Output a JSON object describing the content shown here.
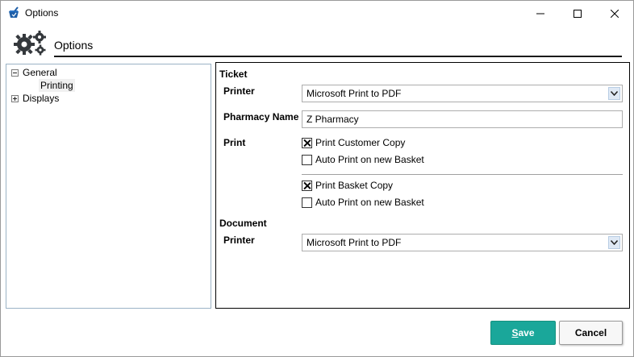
{
  "window": {
    "title": "Options",
    "icons": {
      "app": "pharmacy-mortar-icon",
      "minimize": "minimize-icon",
      "maximize": "maximize-icon",
      "close": "close-icon"
    }
  },
  "header": {
    "title": "Options",
    "icon": "gears-icon"
  },
  "tree": {
    "items": [
      {
        "label": "General",
        "expanded": true,
        "children": [
          {
            "label": "Printing",
            "selected": true
          }
        ]
      },
      {
        "label": "Displays",
        "expanded": false
      }
    ]
  },
  "ticket": {
    "section_title": "Ticket",
    "printer_label": "Printer",
    "printer_value": "Microsoft Print to PDF",
    "pharmacy_name_label": "Pharmacy Name",
    "pharmacy_name_value": "Z Pharmacy",
    "print_label": "Print",
    "options": [
      {
        "label": "Print Customer Copy",
        "checked": true
      },
      {
        "label": "Auto Print on new Basket",
        "checked": false
      },
      {
        "label": "Print Basket Copy",
        "checked": true
      },
      {
        "label": "Auto Print on new Basket",
        "checked": false
      }
    ]
  },
  "document": {
    "section_title": "Document",
    "printer_label": "Printer",
    "printer_value": "Microsoft Print to PDF"
  },
  "buttons": {
    "save_rest": "ave",
    "save_accel": "S",
    "cancel": "Cancel"
  },
  "colors": {
    "save_button": "#1aa79a",
    "panel_border": "#000000",
    "tree_border": "#9bb3c6"
  }
}
